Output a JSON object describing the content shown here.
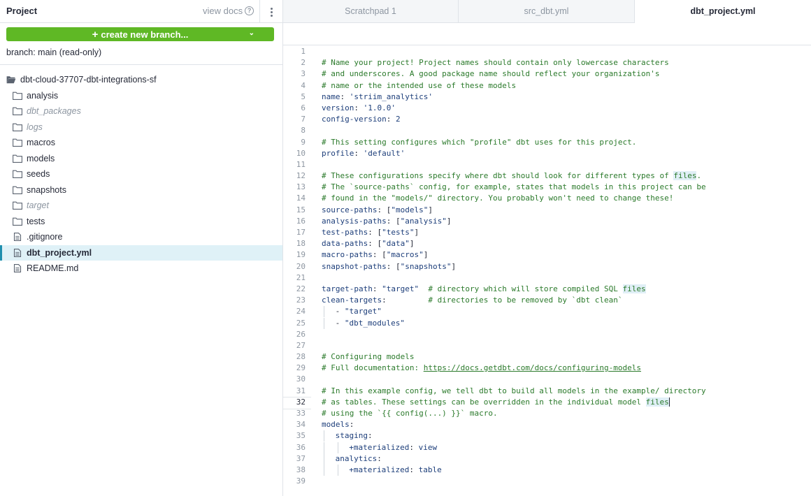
{
  "sidebar": {
    "title": "Project",
    "view_docs": "view docs",
    "help_icon": "?",
    "create_branch": "create new branch...",
    "branch_status": "branch: main (read-only)",
    "tree": [
      {
        "label": "dbt-cloud-37707-dbt-integrations-sf",
        "kind": "folder-open",
        "level": 0,
        "dim": false
      },
      {
        "label": "analysis",
        "kind": "folder",
        "level": 1,
        "dim": false
      },
      {
        "label": "dbt_packages",
        "kind": "folder",
        "level": 1,
        "dim": true
      },
      {
        "label": "logs",
        "kind": "folder",
        "level": 1,
        "dim": true
      },
      {
        "label": "macros",
        "kind": "folder",
        "level": 1,
        "dim": false
      },
      {
        "label": "models",
        "kind": "folder",
        "level": 1,
        "dim": false
      },
      {
        "label": "seeds",
        "kind": "folder",
        "level": 1,
        "dim": false
      },
      {
        "label": "snapshots",
        "kind": "folder",
        "level": 1,
        "dim": false
      },
      {
        "label": "target",
        "kind": "folder",
        "level": 1,
        "dim": true
      },
      {
        "label": "tests",
        "kind": "folder",
        "level": 1,
        "dim": false
      },
      {
        "label": ".gitignore",
        "kind": "file",
        "level": 1,
        "dim": false
      },
      {
        "label": "dbt_project.yml",
        "kind": "file",
        "level": 1,
        "dim": false,
        "selected": true
      },
      {
        "label": "README.md",
        "kind": "file",
        "level": 1,
        "dim": false
      }
    ]
  },
  "tabs": [
    {
      "label": "Scratchpad 1",
      "active": false
    },
    {
      "label": "src_dbt.yml",
      "active": false
    },
    {
      "label": "dbt_project.yml",
      "active": true
    }
  ],
  "editor": {
    "current_line": 32,
    "lines": [
      "",
      "# Name your project! Project names should contain only lowercase characters",
      "# and underscores. A good package name should reflect your organization's",
      "# name or the intended use of these models",
      "name: 'striim_analytics'",
      "version: '1.0.0'",
      "config-version: 2",
      "",
      "# This setting configures which \"profile\" dbt uses for this project.",
      "profile: 'default'",
      "",
      "# These configurations specify where dbt should look for different types of files.",
      "# The `source-paths` config, for example, states that models in this project can be",
      "# found in the \"models/\" directory. You probably won't need to change these!",
      "source-paths: [\"models\"]",
      "analysis-paths: [\"analysis\"]",
      "test-paths: [\"tests\"]",
      "data-paths: [\"data\"]",
      "macro-paths: [\"macros\"]",
      "snapshot-paths: [\"snapshots\"]",
      "",
      "target-path: \"target\"  # directory which will store compiled SQL files",
      "clean-targets:         # directories to be removed by `dbt clean`",
      "  - \"target\"",
      "  - \"dbt_modules\"",
      "",
      "",
      "# Configuring models",
      "# Full documentation: https://docs.getdbt.com/docs/configuring-models",
      "",
      "# In this example config, we tell dbt to build all models in the example/ directory",
      "# as tables. These settings can be overridden in the individual model files",
      "# using the `{{ config(...) }}` macro.",
      "models:",
      "  staging:",
      "    +materialized: view",
      "  analytics:",
      "    +materialized: table",
      ""
    ],
    "highlight_word": "files"
  },
  "colors": {
    "brand_green": "#5fb825",
    "selected_bg": "#dff1f7",
    "selected_bar": "#1f8fae",
    "comment": "#2b7a2b",
    "key": "#1d3e7a"
  }
}
